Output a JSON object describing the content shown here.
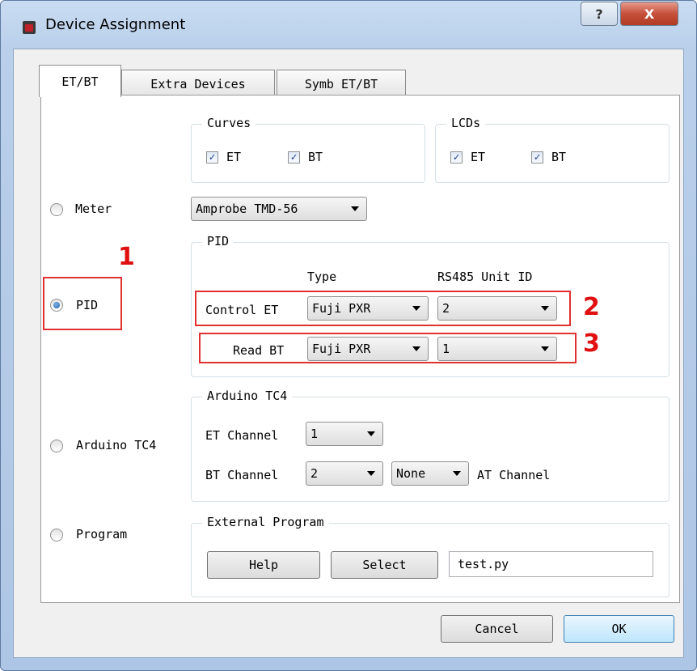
{
  "window": {
    "title": "Device Assignment",
    "help_glyph": "?",
    "close_glyph": "X"
  },
  "tabs": [
    {
      "label": "ET/BT",
      "active": true
    },
    {
      "label": "Extra Devices",
      "active": false
    },
    {
      "label": "Symb ET/BT",
      "active": false
    }
  ],
  "curves": {
    "title": "Curves",
    "et_label": "ET",
    "bt_label": "BT",
    "et_checked": true,
    "bt_checked": true
  },
  "lcds": {
    "title": "LCDs",
    "et_label": "ET",
    "bt_label": "BT",
    "et_checked": true,
    "bt_checked": true
  },
  "meter": {
    "label": "Meter",
    "selected": false,
    "device": "Amprobe TMD-56"
  },
  "pid_option": {
    "label": "PID",
    "selected": true
  },
  "pid": {
    "title": "PID",
    "type_header": "Type",
    "unit_header": "RS485 Unit ID",
    "control_label": "Control ET",
    "control_type": "Fuji PXR",
    "control_unit": "2",
    "read_label": "Read BT",
    "read_type": "Fuji PXR",
    "read_unit": "1"
  },
  "arduino_option": {
    "label": "Arduino TC4",
    "selected": false
  },
  "arduino": {
    "title": "Arduino TC4",
    "et_channel_label": "ET Channel",
    "et_channel": "1",
    "bt_channel_label": "BT Channel",
    "bt_channel": "2",
    "at_value": "None",
    "at_channel_label": "AT Channel"
  },
  "program_option": {
    "label": "Program",
    "selected": false
  },
  "external": {
    "title": "External Program",
    "help_label": "Help",
    "select_label": "Select",
    "file_value": "test.py"
  },
  "buttons": {
    "cancel": "Cancel",
    "ok": "OK"
  },
  "annotations": {
    "n1": "1",
    "n2": "2",
    "n3": "3"
  },
  "colors": {
    "annotation": "#e23030",
    "accent": "#1f5ea8"
  }
}
